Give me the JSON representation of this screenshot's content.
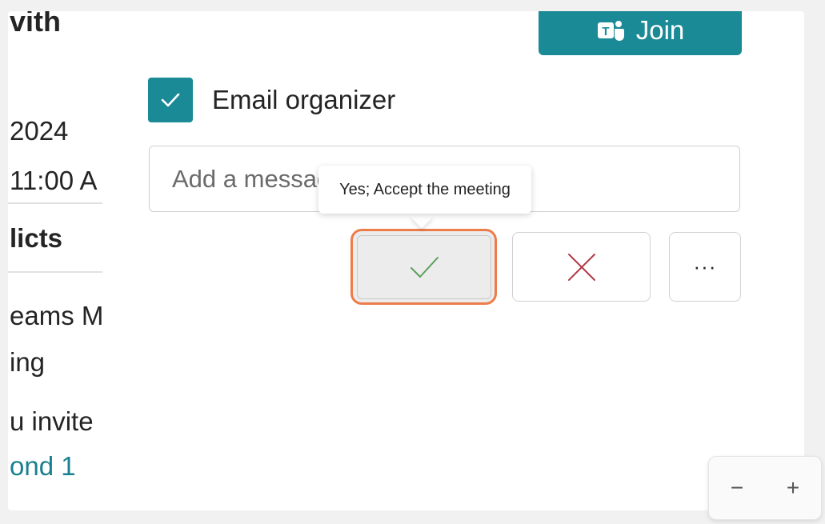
{
  "header": {
    "title_fragment": "vith",
    "join_label": "Join"
  },
  "left_column": {
    "date_fragment": "2024",
    "time_fragment": "11:00 A",
    "conflicts_fragment": "licts",
    "meeting_line1": "eams M",
    "meeting_line2": "ing",
    "invite_fragment": "u invite",
    "respond_fragment": "ond 1"
  },
  "response": {
    "email_organizer_checked": true,
    "email_organizer_label": "Email organizer",
    "message_placeholder": "Add a message",
    "accept_tooltip": "Yes; Accept the meeting",
    "more_label": "···"
  },
  "zoom": {
    "minus": "−",
    "plus": "+"
  },
  "colors": {
    "accent": "#1a8a96",
    "focus_ring": "#ec7d4a",
    "accept_check": "#5aa05a",
    "decline_x": "#b03a48"
  }
}
